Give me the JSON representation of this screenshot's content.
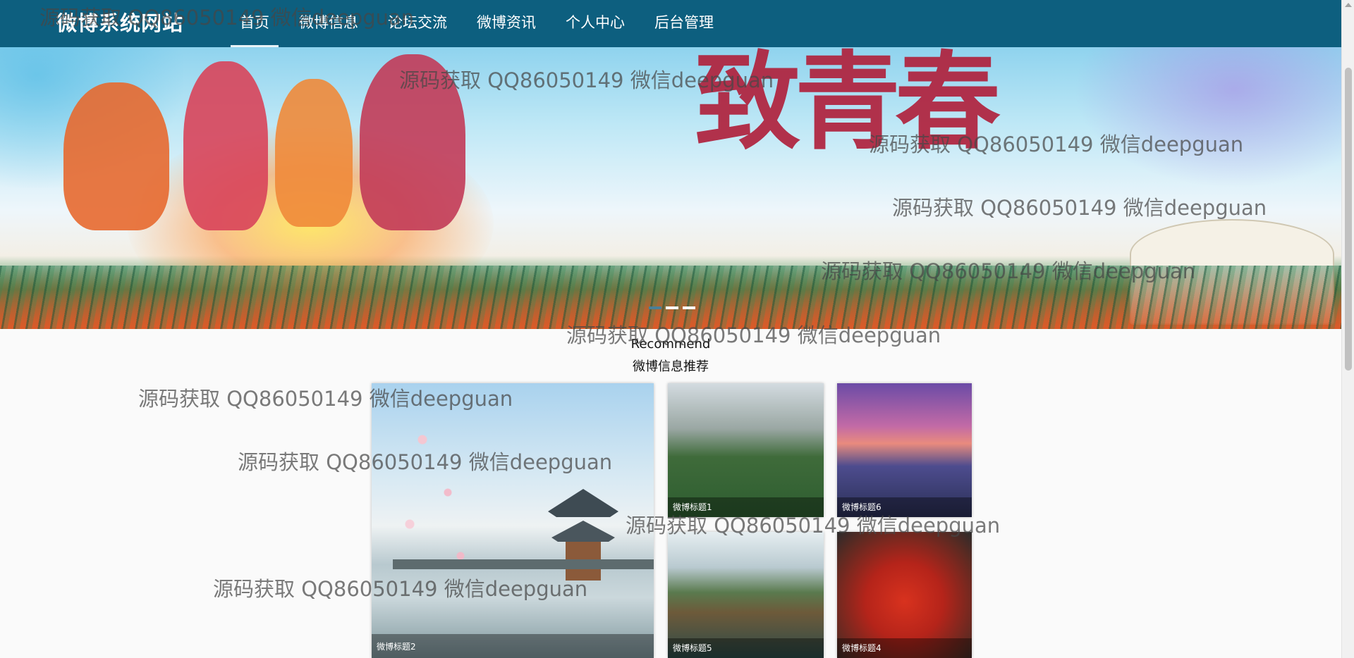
{
  "header": {
    "brand": "微博系统网站",
    "nav": [
      {
        "label": "首页",
        "active": true
      },
      {
        "label": "微博信息",
        "active": false
      },
      {
        "label": "论坛交流",
        "active": false
      },
      {
        "label": "微博资讯",
        "active": false
      },
      {
        "label": "个人中心",
        "active": false
      },
      {
        "label": "后台管理",
        "active": false
      }
    ]
  },
  "banner": {
    "headline": "致青春",
    "dots": [
      "slide-1",
      "slide-2",
      "slide-3"
    ],
    "active_dot": 0
  },
  "recommend": {
    "title_en": "Recommend",
    "title_cn": "微博信息推荐",
    "cards": [
      {
        "caption": "微博标题2"
      },
      {
        "caption": "微博标题1"
      },
      {
        "caption": "微博标题6"
      },
      {
        "caption": "微博标题5"
      },
      {
        "caption": "微博标题4"
      }
    ]
  },
  "watermark": "源码获取 QQ86050149 微信deepguan",
  "colors": {
    "header": "#0d5f7f",
    "nav_text": "#ffffff",
    "page_bg": "#fafafa"
  }
}
